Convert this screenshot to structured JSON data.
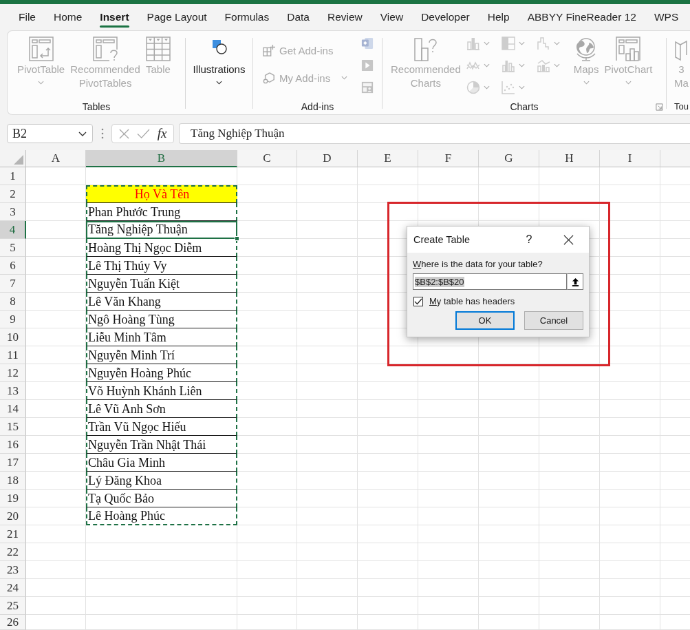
{
  "menu_tabs": [
    {
      "label": "File",
      "selected": false
    },
    {
      "label": "Home",
      "selected": false
    },
    {
      "label": "Insert",
      "selected": true
    },
    {
      "label": "Page Layout",
      "selected": false
    },
    {
      "label": "Formulas",
      "selected": false
    },
    {
      "label": "Data",
      "selected": false
    },
    {
      "label": "Review",
      "selected": false
    },
    {
      "label": "View",
      "selected": false
    },
    {
      "label": "Developer",
      "selected": false
    },
    {
      "label": "Help",
      "selected": false
    },
    {
      "label": "ABBYY FineReader 12",
      "selected": false
    },
    {
      "label": "WPS",
      "selected": false
    }
  ],
  "ribbon": {
    "groups": [
      {
        "label": "Tables",
        "items": [
          {
            "kind": "large",
            "label": "PivotTable",
            "dropdown": true,
            "disabled": true
          },
          {
            "kind": "large",
            "label": "Recommended\nPivotTables",
            "dropdown": false,
            "disabled": true
          },
          {
            "kind": "large",
            "label": "Table",
            "dropdown": false,
            "disabled": true
          }
        ]
      },
      {
        "items": [
          {
            "kind": "large",
            "label": "Illustrations",
            "dropdown": true,
            "disabled": false
          }
        ]
      },
      {
        "label": "Add-ins",
        "items": [
          {
            "kind": "row",
            "label": "Get Add-ins",
            "dropdown": false,
            "disabled": true
          },
          {
            "kind": "row",
            "label": "My Add-ins",
            "dropdown": true,
            "disabled": true
          },
          {
            "kind": "icon",
            "dropdown": false,
            "disabled": true
          },
          {
            "kind": "icon",
            "dropdown": false,
            "disabled": true
          },
          {
            "kind": "icon",
            "dropdown": false,
            "disabled": true
          }
        ]
      },
      {
        "label": "Charts",
        "launcher": true,
        "items": [
          {
            "kind": "large",
            "label": "Recommended\nCharts",
            "dropdown": false,
            "disabled": true
          },
          {
            "kind": "icon",
            "dropdown": true,
            "disabled": true
          },
          {
            "kind": "icon",
            "dropdown": true,
            "disabled": true
          },
          {
            "kind": "icon",
            "dropdown": true,
            "disabled": true
          },
          {
            "kind": "icon",
            "dropdown": true,
            "disabled": true
          },
          {
            "kind": "icon",
            "dropdown": true,
            "disabled": true
          },
          {
            "kind": "icon",
            "dropdown": true,
            "disabled": true
          },
          {
            "kind": "icon",
            "dropdown": true,
            "disabled": true
          },
          {
            "kind": "icon",
            "dropdown": true,
            "disabled": true
          },
          {
            "kind": "large",
            "label": "Maps",
            "dropdown": true,
            "disabled": true
          },
          {
            "kind": "large",
            "label": "PivotChart",
            "dropdown": true,
            "disabled": true
          }
        ]
      },
      {
        "label": "Tou",
        "items": [
          {
            "kind": "large",
            "label": "3\nMa",
            "dropdown": false,
            "disabled": true
          }
        ]
      }
    ]
  },
  "formula_bar": {
    "name_box": "B2",
    "function_button": "fx",
    "formula": "Tăng Nghiệp Thuận"
  },
  "grid": {
    "copy_marquee": true,
    "columns": [
      {
        "label": "A",
        "selected": false
      },
      {
        "label": "B",
        "selected": true
      },
      {
        "label": "C",
        "selected": false
      },
      {
        "label": "D",
        "selected": false
      },
      {
        "label": "E",
        "selected": false
      },
      {
        "label": "F",
        "selected": false
      },
      {
        "label": "G",
        "selected": false
      },
      {
        "label": "H",
        "selected": false
      },
      {
        "label": "I",
        "selected": false
      },
      {
        "selected": false
      }
    ],
    "rows": [
      {
        "label": "1",
        "selected": false
      },
      {
        "label": "2",
        "selected": false,
        "cell_b": {
          "kind": "header",
          "text": "Họ Và Tên",
          "active": false
        }
      },
      {
        "label": "3",
        "selected": false,
        "cell_b": {
          "kind": "name",
          "text": "Phan Phước Trung",
          "active": false
        }
      },
      {
        "label": "4",
        "selected": true,
        "cell_b": {
          "kind": "name",
          "text": "Tăng Nghiệp Thuận",
          "active": true
        }
      },
      {
        "label": "5",
        "selected": false,
        "cell_b": {
          "kind": "name",
          "text": "Hoàng Thị Ngọc Diễm",
          "active": false
        }
      },
      {
        "label": "6",
        "selected": false,
        "cell_b": {
          "kind": "name",
          "text": "Lê Thị Thúy Vy",
          "active": false
        }
      },
      {
        "label": "7",
        "selected": false,
        "cell_b": {
          "kind": "name",
          "text": "Nguyễn Tuấn Kiệt",
          "active": false
        }
      },
      {
        "label": "8",
        "selected": false,
        "cell_b": {
          "kind": "name",
          "text": "Lê Văn Khang",
          "active": false
        }
      },
      {
        "label": "9",
        "selected": false,
        "cell_b": {
          "kind": "name",
          "text": "Ngô Hoàng Tùng",
          "active": false
        }
      },
      {
        "label": "10",
        "selected": false,
        "cell_b": {
          "kind": "name",
          "text": "Liễu Minh Tâm",
          "active": false
        }
      },
      {
        "label": "11",
        "selected": false,
        "cell_b": {
          "kind": "name",
          "text": "Nguyễn Minh Trí",
          "active": false
        }
      },
      {
        "label": "12",
        "selected": false,
        "cell_b": {
          "kind": "name",
          "text": "Nguyễn Hoàng Phúc",
          "active": false
        }
      },
      {
        "label": "13",
        "selected": false,
        "cell_b": {
          "kind": "name",
          "text": "Võ Huỳnh Khánh Liên",
          "active": false
        }
      },
      {
        "label": "14",
        "selected": false,
        "cell_b": {
          "kind": "name",
          "text": "Lê Vũ Anh Sơn",
          "active": false
        }
      },
      {
        "label": "15",
        "selected": false,
        "cell_b": {
          "kind": "name",
          "text": "Trần Vũ Ngọc Hiếu",
          "active": false
        }
      },
      {
        "label": "16",
        "selected": false,
        "cell_b": {
          "kind": "name",
          "text": "Nguyễn Trần Nhật Thái",
          "active": false
        }
      },
      {
        "label": "17",
        "selected": false,
        "cell_b": {
          "kind": "name",
          "text": "Châu Gia Minh",
          "active": false
        }
      },
      {
        "label": "18",
        "selected": false,
        "cell_b": {
          "kind": "name",
          "text": "Lý Đăng Khoa",
          "active": false
        }
      },
      {
        "label": "19",
        "selected": false,
        "cell_b": {
          "kind": "name",
          "text": "Tạ Quốc Bảo",
          "active": false
        }
      },
      {
        "label": "20",
        "selected": false,
        "cell_b": {
          "kind": "name",
          "text": "Lê Hoàng Phúc",
          "active": false
        }
      },
      {
        "label": "21",
        "selected": false
      },
      {
        "label": "22",
        "selected": false
      },
      {
        "label": "23",
        "selected": false
      },
      {
        "label": "24",
        "selected": false
      },
      {
        "label": "25",
        "selected": false
      },
      {
        "label": "26",
        "selected": false
      }
    ]
  },
  "dialog": {
    "title": "Create Table",
    "help_button": "?",
    "prompt": "Where is the data for your table?",
    "range_field": {
      "value": "$B$2:$B$20",
      "highlighted": true
    },
    "headers_checkbox": {
      "label": "My table has headers",
      "checked": true
    },
    "buttons": [
      {
        "label": "OK",
        "default": true
      },
      {
        "label": "Cancel",
        "default": false
      }
    ]
  }
}
